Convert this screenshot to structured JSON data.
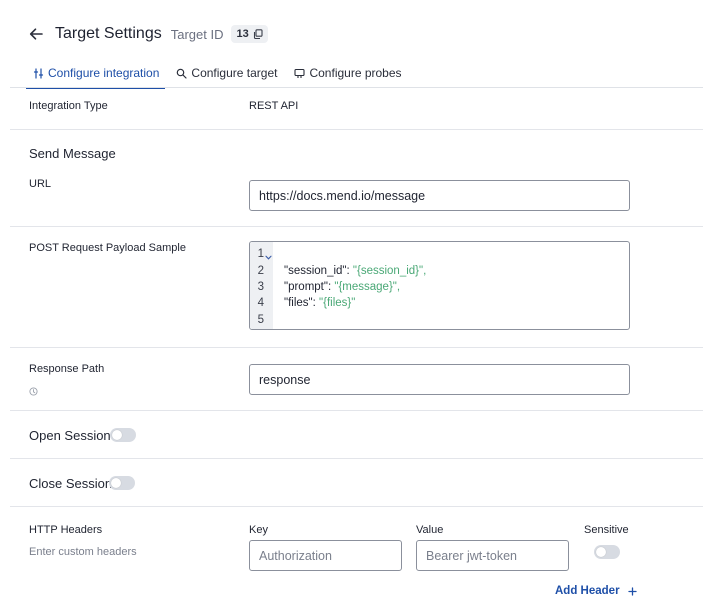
{
  "header": {
    "title": "Target Settings",
    "target_id_label": "Target ID",
    "target_id_value": "13"
  },
  "tabs": [
    {
      "label": "Configure integration",
      "icon": "integration-icon",
      "active": true
    },
    {
      "label": "Configure target",
      "icon": "magnifier-icon",
      "active": false
    },
    {
      "label": "Configure probes",
      "icon": "probe-icon",
      "active": false
    }
  ],
  "integration": {
    "type_label": "Integration Type",
    "type_value": "REST API"
  },
  "send_message": {
    "section_label": "Send Message",
    "url_label": "URL",
    "url_value": "https://docs.mend.io/message",
    "payload_label": "POST Request Payload Sample",
    "payload_lines": [
      {
        "n": "1",
        "key": "",
        "val": ""
      },
      {
        "n": "2",
        "key": "\"session_id\": ",
        "val": "\"{session_id}\","
      },
      {
        "n": "3",
        "key": "\"prompt\": ",
        "val": "\"{message}\","
      },
      {
        "n": "4",
        "key": "\"files\": ",
        "val": "\"{files}\""
      },
      {
        "n": "5",
        "key": "",
        "val": ""
      }
    ],
    "response_path_label": "Response Path",
    "response_path_value": "response"
  },
  "open_session": {
    "label": "Open Session",
    "enabled": false
  },
  "close_session": {
    "label": "Close Session",
    "enabled": false
  },
  "http_headers": {
    "label": "HTTP Headers",
    "hint": "Enter custom headers",
    "key_label": "Key",
    "value_label": "Value",
    "sensitive_label": "Sensitive",
    "key_placeholder": "Authorization",
    "value_placeholder": "Bearer jwt-token",
    "sensitive_enabled": false,
    "add_label": "Add Header"
  },
  "colors": {
    "accent": "#1e4fa8",
    "string": "#4aa876",
    "toggle_off": "#d7dbe2"
  }
}
